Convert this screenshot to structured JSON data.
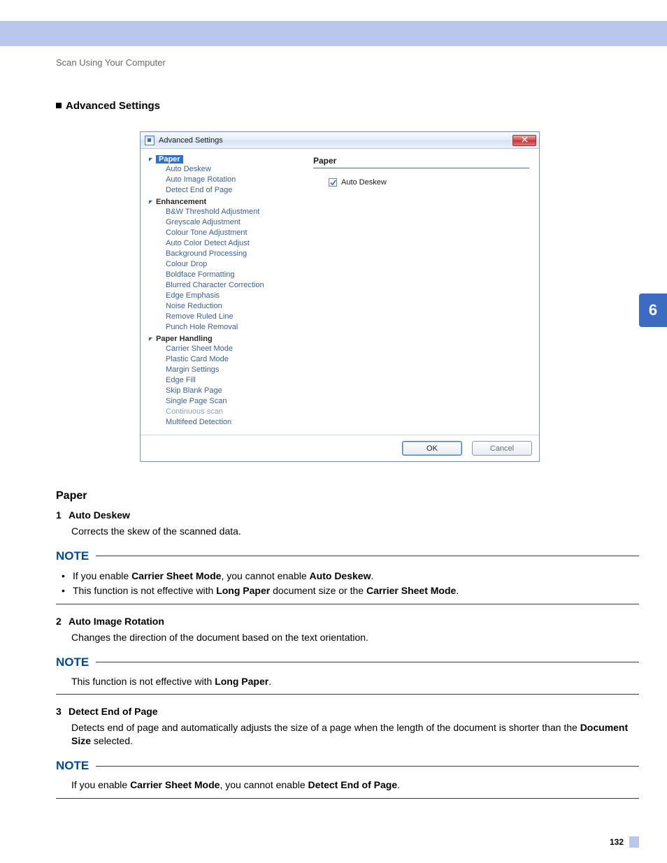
{
  "breadcrumb": "Scan Using Your Computer",
  "section_title": "Advanced Settings",
  "side_tab": "6",
  "page_number": "132",
  "dialog": {
    "title": "Advanced Settings",
    "ok": "OK",
    "cancel": "Cancel",
    "panel_title": "Paper",
    "checkbox_label": "Auto Deskew",
    "tree": {
      "paper": {
        "label": "Paper",
        "items": [
          "Auto Deskew",
          "Auto Image Rotation",
          "Detect End of Page"
        ]
      },
      "enhancement": {
        "label": "Enhancement",
        "items": [
          "B&W Threshold Adjustment",
          "Greyscale Adjustment",
          "Colour Tone Adjustment",
          "Auto Color Detect Adjust",
          "Background Processing",
          "Colour Drop",
          "Boldface Formatting",
          "Blurred Character Correction",
          "Edge Emphasis",
          "Noise Reduction",
          "Remove Ruled Line",
          "Punch Hole Removal"
        ]
      },
      "paper_handling": {
        "label": "Paper Handling",
        "items": [
          "Carrier Sheet Mode",
          "Plastic Card Mode",
          "Margin Settings",
          "Edge Fill",
          "Skip Blank Page",
          "Single Page Scan",
          "Continuous scan",
          "Multifeed Detection"
        ]
      }
    }
  },
  "body": {
    "paper_heading": "Paper",
    "item1_num": "1",
    "item1_title": "Auto Deskew",
    "item1_text": "Corrects the skew of the scanned data.",
    "note_label": "NOTE",
    "note1_b1_pre": "If you enable ",
    "note1_b1_bold1": "Carrier Sheet Mode",
    "note1_b1_mid": ", you cannot enable ",
    "note1_b1_bold2": "Auto Deskew",
    "note1_b1_post": ".",
    "note1_b2_pre": "This function is not effective with ",
    "note1_b2_bold1": "Long Paper",
    "note1_b2_mid": " document size or the ",
    "note1_b2_bold2": "Carrier Sheet Mode",
    "note1_b2_post": ".",
    "item2_num": "2",
    "item2_title": "Auto Image Rotation",
    "item2_text": "Changes the direction of the document based on the text orientation.",
    "note2_pre": "This function is not effective with ",
    "note2_bold": "Long Paper",
    "note2_post": ".",
    "item3_num": "3",
    "item3_title": "Detect End of Page",
    "item3_text_pre": "Detects end of page and automatically adjusts the size of a page when the length of the document is shorter than the ",
    "item3_text_bold": "Document Size",
    "item3_text_post": " selected.",
    "note3_pre": "If you enable ",
    "note3_bold1": "Carrier Sheet Mode",
    "note3_mid": ", you cannot enable ",
    "note3_bold2": "Detect End of Page",
    "note3_post": "."
  }
}
